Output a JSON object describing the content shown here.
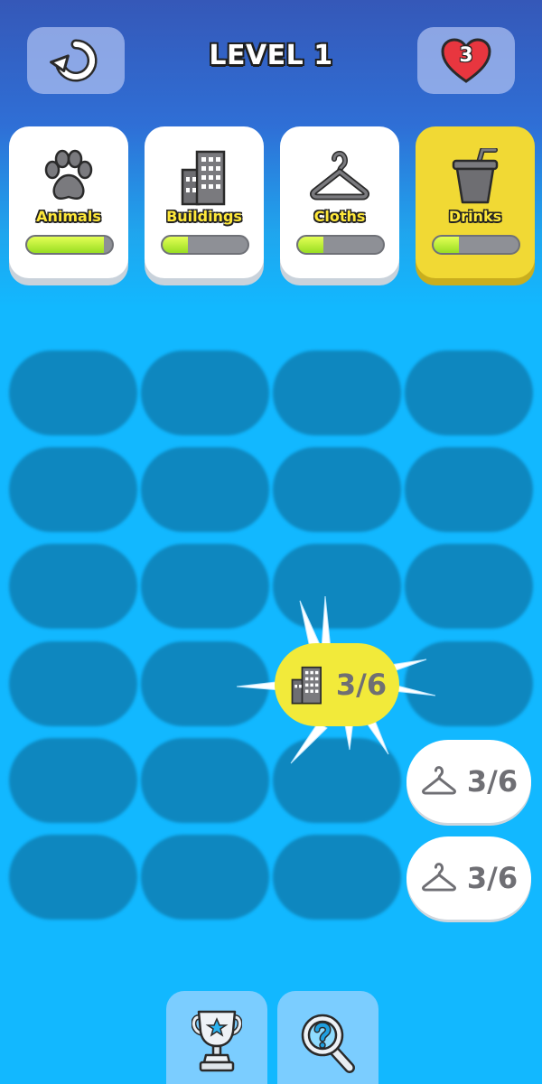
{
  "header": {
    "level_title": "LEVEL 1",
    "lives": "3",
    "reset_icon": "reset-icon",
    "lives_icon": "heart-icon"
  },
  "categories": [
    {
      "label": "Animals",
      "icon": "paw-icon",
      "progress": 0.9,
      "active": false
    },
    {
      "label": "Buildings",
      "icon": "building-icon",
      "progress": 0.3,
      "active": false
    },
    {
      "label": "Cloths",
      "icon": "hanger-icon",
      "progress": 0.3,
      "active": false
    },
    {
      "label": "Drinks",
      "icon": "cup-icon",
      "progress": 0.3,
      "active": true
    }
  ],
  "tiles": [
    {
      "icon": "building-icon",
      "count": "3/6",
      "state": "selected"
    },
    {
      "icon": "hanger-icon",
      "count": "3/6",
      "state": "idle"
    },
    {
      "icon": "hanger-icon",
      "count": "3/6",
      "state": "idle"
    }
  ],
  "footer": {
    "trophy_icon": "trophy-icon",
    "search_icon": "magnifier-hint-icon"
  },
  "colors": {
    "active_card": "#f1d934",
    "slot": "#0e87bf",
    "background": "#12b8ff",
    "progress_fill": "#b8ee33"
  }
}
